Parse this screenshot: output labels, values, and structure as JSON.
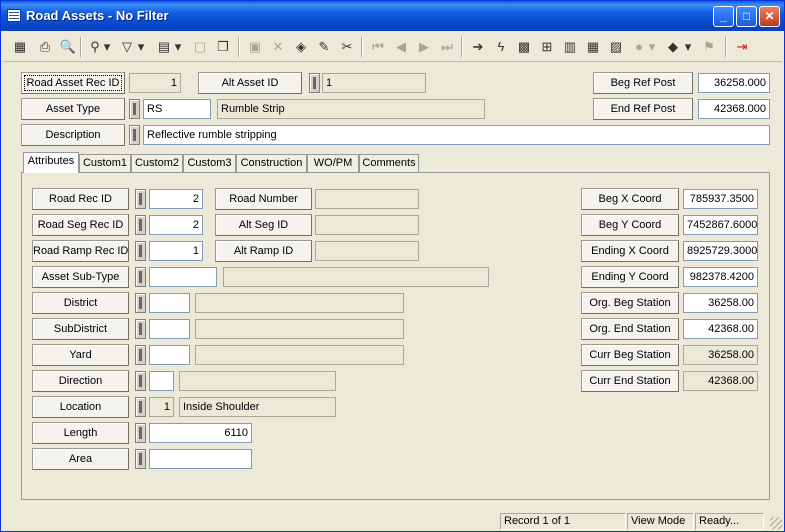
{
  "window": {
    "title": "Road Assets - No Filter"
  },
  "titlebar_buttons": {
    "minimize": "_",
    "maximize": "□",
    "close": "✕"
  },
  "toolbar": {
    "tools": [
      {
        "name": "record-icon",
        "glyph": "▦",
        "enabled": false
      },
      {
        "name": "print-icon",
        "glyph": "⎙",
        "enabled": true
      },
      {
        "name": "print-preview-icon",
        "glyph": "🔍",
        "enabled": true
      },
      {
        "name": "find-icon",
        "glyph": "⚲",
        "enabled": true
      },
      {
        "name": "filter-icon",
        "glyph": "▽",
        "enabled": true
      },
      {
        "name": "report-icon",
        "glyph": "▤",
        "enabled": true
      },
      {
        "name": "new-record-icon",
        "glyph": "▢",
        "enabled": false
      },
      {
        "name": "copy-icon",
        "glyph": "❐",
        "enabled": true
      },
      {
        "name": "save-icon",
        "glyph": "▣",
        "enabled": false
      },
      {
        "name": "delete-icon",
        "glyph": "✕",
        "enabled": false
      },
      {
        "name": "layers-icon",
        "glyph": "◈",
        "enabled": true
      },
      {
        "name": "edit-icon",
        "glyph": "✎",
        "enabled": true
      },
      {
        "name": "cut-icon",
        "glyph": "✂",
        "enabled": true
      },
      {
        "name": "first-record-icon",
        "glyph": "⏮",
        "enabled": false
      },
      {
        "name": "prev-record-icon",
        "glyph": "◀",
        "enabled": false
      },
      {
        "name": "next-record-icon",
        "glyph": "▶",
        "enabled": false
      },
      {
        "name": "last-record-icon",
        "glyph": "⏭",
        "enabled": false
      },
      {
        "name": "goto-icon",
        "glyph": "➔",
        "enabled": true
      },
      {
        "name": "lightning-icon",
        "glyph": "ϟ",
        "enabled": true
      },
      {
        "name": "map-icon",
        "glyph": "▩",
        "enabled": true
      },
      {
        "name": "tree-icon",
        "glyph": "⊞",
        "enabled": true
      },
      {
        "name": "chart-icon",
        "glyph": "▥",
        "enabled": true
      },
      {
        "name": "calculator-icon",
        "glyph": "▦",
        "enabled": true
      },
      {
        "name": "image-icon",
        "glyph": "▨",
        "enabled": true
      },
      {
        "name": "globe-icon",
        "glyph": "●",
        "enabled": false
      },
      {
        "name": "book-icon",
        "glyph": "◆",
        "enabled": true
      },
      {
        "name": "flag-icon",
        "glyph": "⚑",
        "enabled": false
      },
      {
        "name": "exit-icon",
        "glyph": "⇥",
        "enabled": true
      }
    ]
  },
  "header": {
    "road_asset_rec_id": {
      "label": "Road Asset Rec ID",
      "value": "1"
    },
    "alt_asset_id": {
      "label": "Alt Asset ID",
      "value": "1"
    },
    "asset_type": {
      "label": "Asset Type",
      "code": "RS",
      "name": "Rumble Strip"
    },
    "description": {
      "label": "Description",
      "value": "Reflective rumble stripping"
    },
    "beg_ref_post": {
      "label": "Beg Ref Post",
      "value": "36258.000"
    },
    "end_ref_post": {
      "label": "End Ref Post",
      "value": "42368.000"
    }
  },
  "tabs": [
    "Attributes",
    "Custom1",
    "Custom2",
    "Custom3",
    "Construction",
    "WO/PM",
    "Comments"
  ],
  "attributes": {
    "road_rec_id": {
      "label": "Road Rec ID",
      "value": "2"
    },
    "road_number": {
      "label": "Road Number",
      "value": ""
    },
    "road_seg_rec_id": {
      "label": "Road Seg Rec ID",
      "value": "2"
    },
    "alt_seg_id": {
      "label": "Alt Seg ID",
      "value": ""
    },
    "road_ramp_rec_id": {
      "label": "Road Ramp Rec ID",
      "value": "1"
    },
    "alt_ramp_id": {
      "label": "Alt Ramp ID",
      "value": ""
    },
    "asset_sub_type": {
      "label": "Asset Sub-Type",
      "code": "",
      "name": ""
    },
    "district": {
      "label": "District",
      "code": "",
      "name": ""
    },
    "subdistrict": {
      "label": "SubDistrict",
      "code": "",
      "name": ""
    },
    "yard": {
      "label": "Yard",
      "code": "",
      "name": ""
    },
    "direction": {
      "label": "Direction",
      "code": "",
      "name": ""
    },
    "location": {
      "label": "Location",
      "code": "1",
      "name": "Inside Shoulder"
    },
    "length": {
      "label": "Length",
      "value": "6110"
    },
    "area": {
      "label": "Area",
      "value": ""
    }
  },
  "coords": {
    "beg_x": {
      "label": "Beg X Coord",
      "value": "785937.3500"
    },
    "beg_y": {
      "label": "Beg Y Coord",
      "value": "7452867.6000"
    },
    "end_x": {
      "label": "Ending X Coord",
      "value": "8925729.3000"
    },
    "end_y": {
      "label": "Ending Y Coord",
      "value": "982378.4200"
    },
    "org_beg_station": {
      "label": "Org. Beg Station",
      "value": "36258.00"
    },
    "org_end_station": {
      "label": "Org. End Station",
      "value": "42368.00"
    },
    "curr_beg_station": {
      "label": "Curr Beg Station",
      "value": "36258.00"
    },
    "curr_end_station": {
      "label": "Curr End Station",
      "value": "42368.00"
    }
  },
  "status": {
    "record": "Record 1 of 1",
    "mode": "View Mode",
    "state": "Ready..."
  }
}
